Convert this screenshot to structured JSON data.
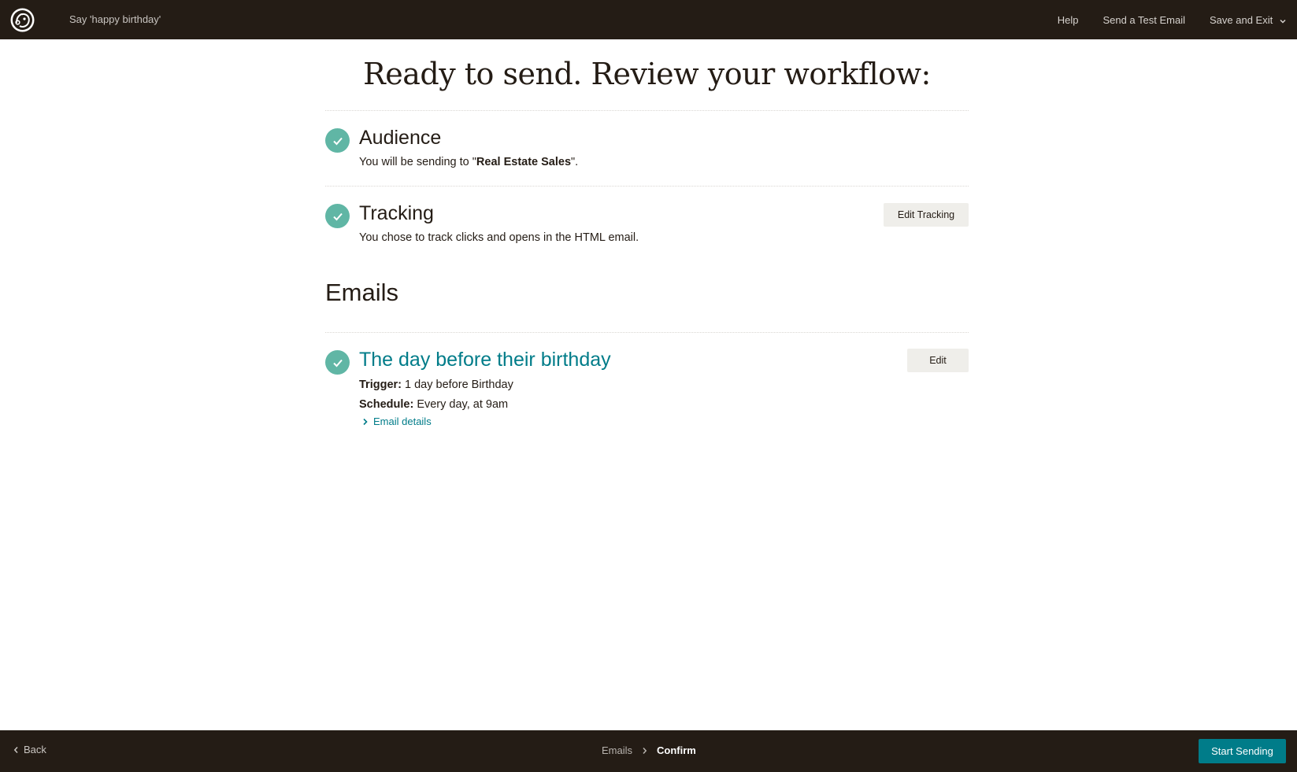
{
  "topbar": {
    "campaign_name": "Say 'happy birthday'",
    "links": {
      "help": "Help",
      "test_email": "Send a Test Email",
      "save_exit": "Save and Exit"
    }
  },
  "page_title": "Ready to send. Review your workflow:",
  "audience": {
    "title": "Audience",
    "desc_prefix": "You will be sending to \"",
    "list_name": "Real Estate Sales",
    "desc_suffix": "\"."
  },
  "tracking": {
    "title": "Tracking",
    "desc": "You chose to track clicks and opens in the HTML email.",
    "button": "Edit Tracking"
  },
  "emails": {
    "heading": "Emails",
    "items": [
      {
        "title": "The day before their birthday",
        "trigger_label": "Trigger:",
        "trigger_value": " 1 day before Birthday",
        "schedule_label": "Schedule:",
        "schedule_value": " Every day, at 9am",
        "details_link": "Email details",
        "edit_button": "Edit"
      }
    ]
  },
  "bottombar": {
    "back": "Back",
    "breadcrumbs": [
      "Emails",
      "Confirm"
    ],
    "start_button": "Start Sending"
  },
  "colors": {
    "dark": "#241c15",
    "accent": "#007c89",
    "check": "#60b6a5"
  }
}
